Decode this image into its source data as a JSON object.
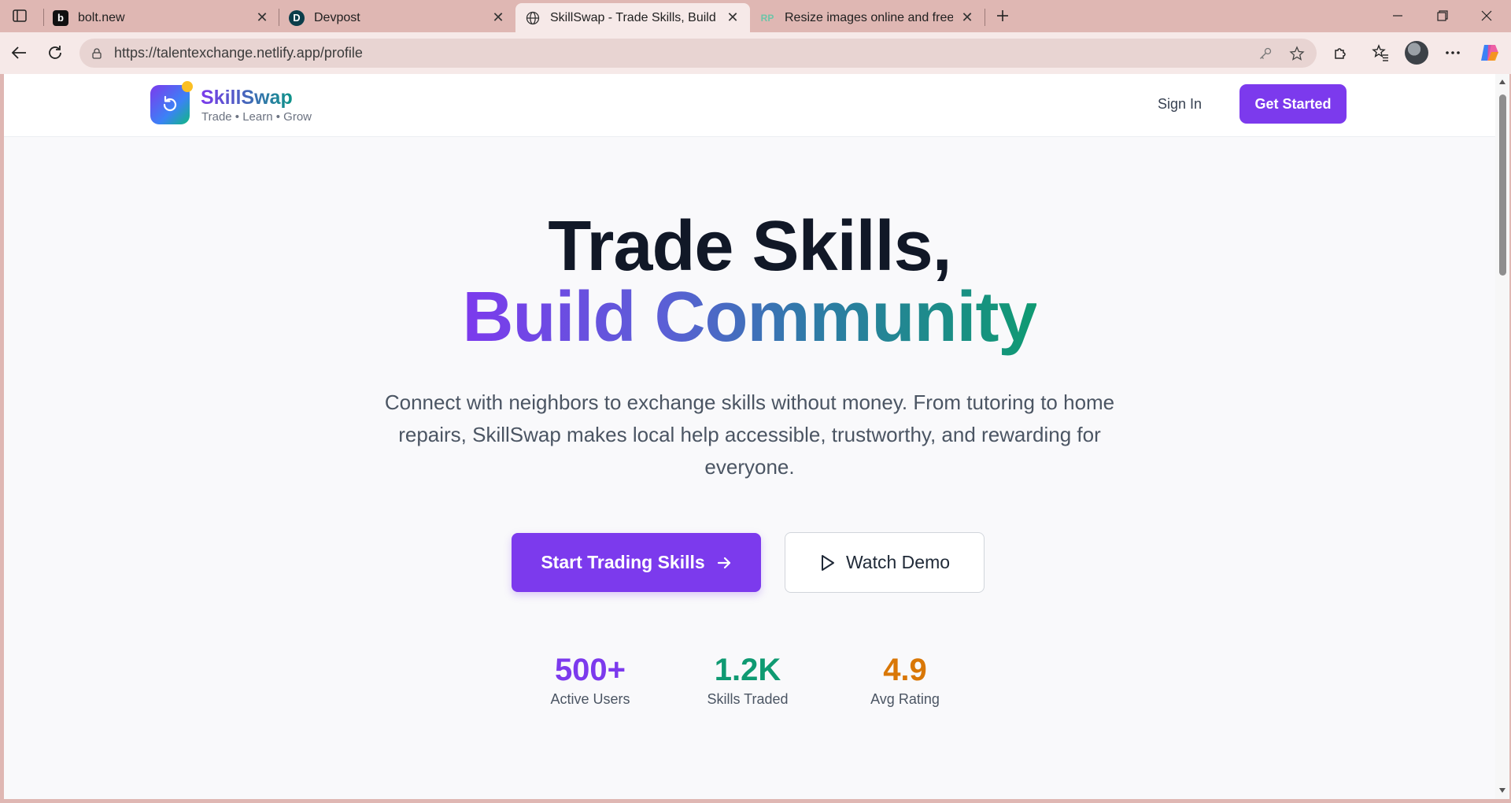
{
  "browser": {
    "tabs": [
      {
        "title": "bolt.new",
        "favicon": "b"
      },
      {
        "title": "Devpost",
        "favicon": "D"
      },
      {
        "title": "SkillSwap - Trade Skills, Build Com",
        "favicon": "globe"
      },
      {
        "title": "Resize images online and free - Re",
        "favicon": "RP"
      }
    ],
    "url": "https://talentexchange.netlify.app/profile"
  },
  "header": {
    "brand_name": "SkillSwap",
    "brand_tagline": "Trade • Learn • Grow",
    "sign_in": "Sign In",
    "get_started": "Get Started"
  },
  "hero": {
    "line1": "Trade Skills,",
    "line2": "Build Community",
    "subtitle": "Connect with neighbors to exchange skills without money. From tutoring to home repairs, SkillSwap makes local help accessible, trustworthy, and rewarding for everyone.",
    "primary_button": "Start Trading Skills",
    "secondary_button": "Watch Demo"
  },
  "stats": [
    {
      "value": "500+",
      "label": "Active Users",
      "color": "#7c3aed"
    },
    {
      "value": "1.2K",
      "label": "Skills Traded",
      "color": "#0f9a72"
    },
    {
      "value": "4.9",
      "label": "Avg Rating",
      "color": "#d97706"
    }
  ],
  "colors": {
    "accent": "#7c3aed",
    "teal": "#0f9a72",
    "amber": "#d97706",
    "chrome": "#dfb7b3"
  }
}
